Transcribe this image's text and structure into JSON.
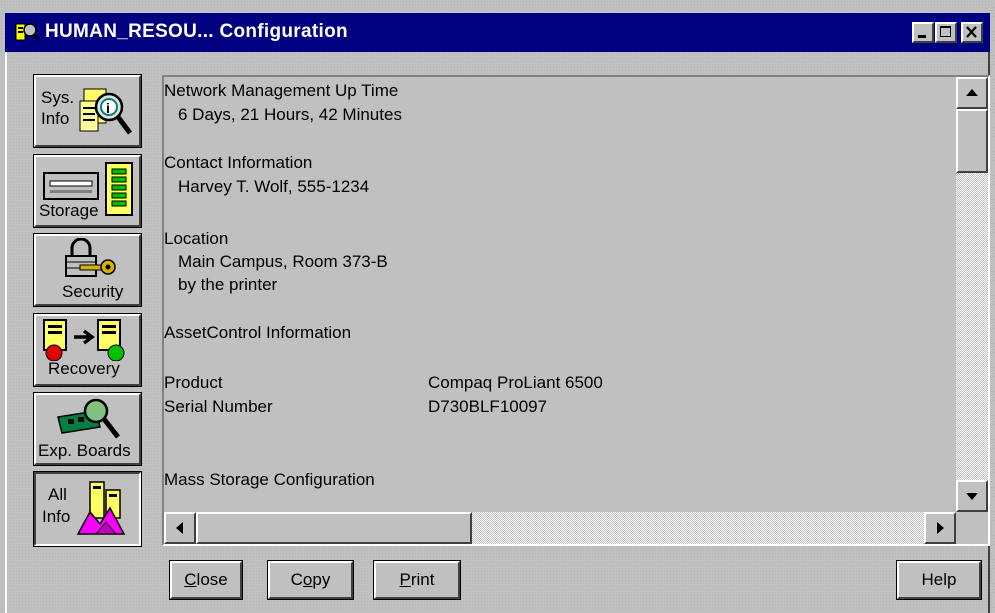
{
  "window": {
    "title": "HUMAN_RESOU... Configuration",
    "title_icon": "compaq-insight-icon",
    "controls": [
      "minimize",
      "maximize",
      "close"
    ]
  },
  "nav": [
    {
      "line1": "Sys.",
      "line2": "Info",
      "icon": "system-info-magnifier-icon"
    },
    {
      "line1": "",
      "line2": "Storage",
      "icon": "storage-drive-icon"
    },
    {
      "line1": "",
      "line2": "Security",
      "icon": "padlock-key-icon"
    },
    {
      "line1": "",
      "line2": "Recovery",
      "icon": "recovery-servers-icon"
    },
    {
      "line1": "",
      "line2": "Exp. Boards",
      "icon": "expansion-board-magnifier-icon"
    },
    {
      "line1": "All",
      "line2": "Info",
      "icon": "all-info-buildings-icon"
    }
  ],
  "content": {
    "uptime_label": "Network Management Up Time",
    "uptime_value": "6 Days, 21 Hours, 42 Minutes",
    "contact_label": "Contact Information",
    "contact_value": "Harvey T. Wolf, 555-1234",
    "location_label": "Location",
    "location_line1": "Main Campus, Room 373-B",
    "location_line2": "by the printer",
    "asset_label": "AssetControl Information",
    "product_label": "Product",
    "product_value": "Compaq ProLiant 6500",
    "serial_label": "Serial Number",
    "serial_value": "D730BLF10097",
    "mass_storage_label": "Mass Storage Configuration"
  },
  "buttons": {
    "close_first": "C",
    "close_rest": "lose",
    "copy_first": "C",
    "copy_mid": "o",
    "copy_rest": "py",
    "print_first": "P",
    "print_rest": "rint",
    "help": "Help"
  }
}
